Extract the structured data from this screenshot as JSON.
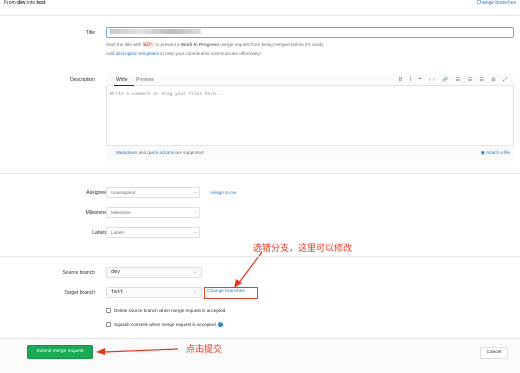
{
  "header": {
    "from_prefix": "From ",
    "source": "dev",
    "into": " into ",
    "target": "test",
    "change_branches": "Change branches"
  },
  "title_field": {
    "label": "Title",
    "value_prefix": "",
    "value_suffix": "",
    "help_prefix": "Start the title with ",
    "help_code": "WIP:",
    "help_middle": " to prevent a ",
    "help_bold": "Work In Progress",
    "help_suffix": " merge request from being merged before it's ready.",
    "help2_prefix": "Add ",
    "help2_link": "description templates",
    "help2_suffix": " to help your contributors communicate effectively!"
  },
  "description": {
    "label": "Description",
    "tab_write": "Write",
    "tab_preview": "Preview",
    "toolbar": "B I ❝ ‹› 🔗 ☰ ☰ ☰ ⊞ ⤢",
    "placeholder": "Write a comment or drag your files here...",
    "md_link": "Markdown",
    "md_and": " and ",
    "qa_link": "quick actions",
    "md_suffix": " are supported",
    "attach": "Attach a file"
  },
  "assignee": {
    "label": "Assignee",
    "value": "Unassigned",
    "assign_me": "Assign to me"
  },
  "milestone": {
    "label": "Milestone",
    "value": "Milestone"
  },
  "labels": {
    "label": "Labels",
    "value": "Labels"
  },
  "annotation_top": "选错分支，这里可以修改",
  "source_branch": {
    "label": "Source branch",
    "value": "dev"
  },
  "target_branch": {
    "label": "Target branch",
    "value": "test",
    "change": "Change branches"
  },
  "options": {
    "delete_source": "Delete source branch when merge request is accepted.",
    "squash": "Squash commits when merge request is accepted.",
    "squash_help": "?"
  },
  "footer": {
    "submit": "Submit merge request",
    "annotation": "点击提交",
    "cancel": "Cancel"
  }
}
